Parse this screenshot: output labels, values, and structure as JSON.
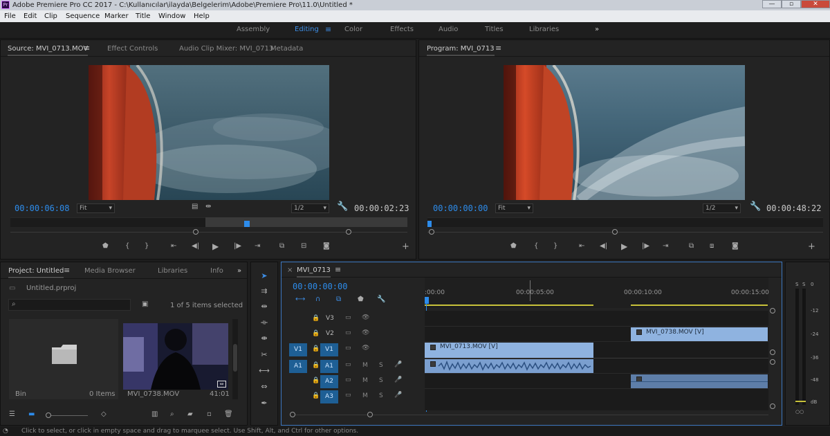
{
  "window": {
    "title": "Adobe Premiere Pro CC 2017 - C:\\Kullanıcılar\\ilayda\\Belgelerim\\Adobe\\Premiere Pro\\11.0\\Untitled *",
    "app_icon": "Pr"
  },
  "menu": [
    "File",
    "Edit",
    "Clip",
    "Sequence",
    "Marker",
    "Title",
    "Window",
    "Help"
  ],
  "workspaces": {
    "items": [
      "Assembly",
      "Editing",
      "Color",
      "Effects",
      "Audio",
      "Titles",
      "Libraries"
    ],
    "active": "Editing",
    "more": "»"
  },
  "source": {
    "tabs": [
      "Source: MVI_0713.MOV",
      "Effect Controls",
      "Audio Clip Mixer: MVI_0713",
      "Metadata"
    ],
    "timecode": "00:00:06:08",
    "fit": "Fit",
    "resolution": "1/2",
    "duration": "00:00:02:23"
  },
  "program": {
    "tab": "Program: MVI_0713",
    "timecode": "00:00:00:00",
    "fit": "Fit",
    "resolution": "1/2",
    "duration": "00:00:48:22"
  },
  "project": {
    "tabs": [
      "Project: Untitled",
      "Media Browser",
      "Libraries",
      "Info"
    ],
    "more": "»",
    "file": "Untitled.prproj",
    "selection": "1 of 5 items selected",
    "bin": {
      "name": "Bin",
      "count": "0 Items"
    },
    "clip": {
      "name": "MVI_0738.MOV",
      "duration": "41:01"
    }
  },
  "timeline": {
    "close": "×",
    "sequence": "MVI_0713",
    "timecode": "00:00:00:00",
    "ruler": [
      ":00:00",
      "00:00:05:00",
      "00:00:10:00",
      "00:00:15:00"
    ],
    "tracks": [
      {
        "src": "",
        "name": "V3"
      },
      {
        "src": "",
        "name": "V2"
      },
      {
        "src": "V1",
        "name": "V1"
      },
      {
        "src": "A1",
        "name": "A1"
      },
      {
        "src": "",
        "name": "A2"
      },
      {
        "src": "",
        "name": "A3"
      }
    ],
    "audio_buttons": [
      "M",
      "S"
    ],
    "clips": {
      "v1": "MVI_0713.MOV [V]",
      "v2": "MVI_0738.MOV [V]"
    }
  },
  "meter": {
    "labels": [
      "0",
      "-12",
      "-24",
      "-36",
      "-48",
      "dB"
    ],
    "top_labels": [
      "S",
      "S"
    ]
  },
  "status": "Click to select, or click in empty space and drag to marquee select. Use Shift, Alt, and Ctrl for other options."
}
